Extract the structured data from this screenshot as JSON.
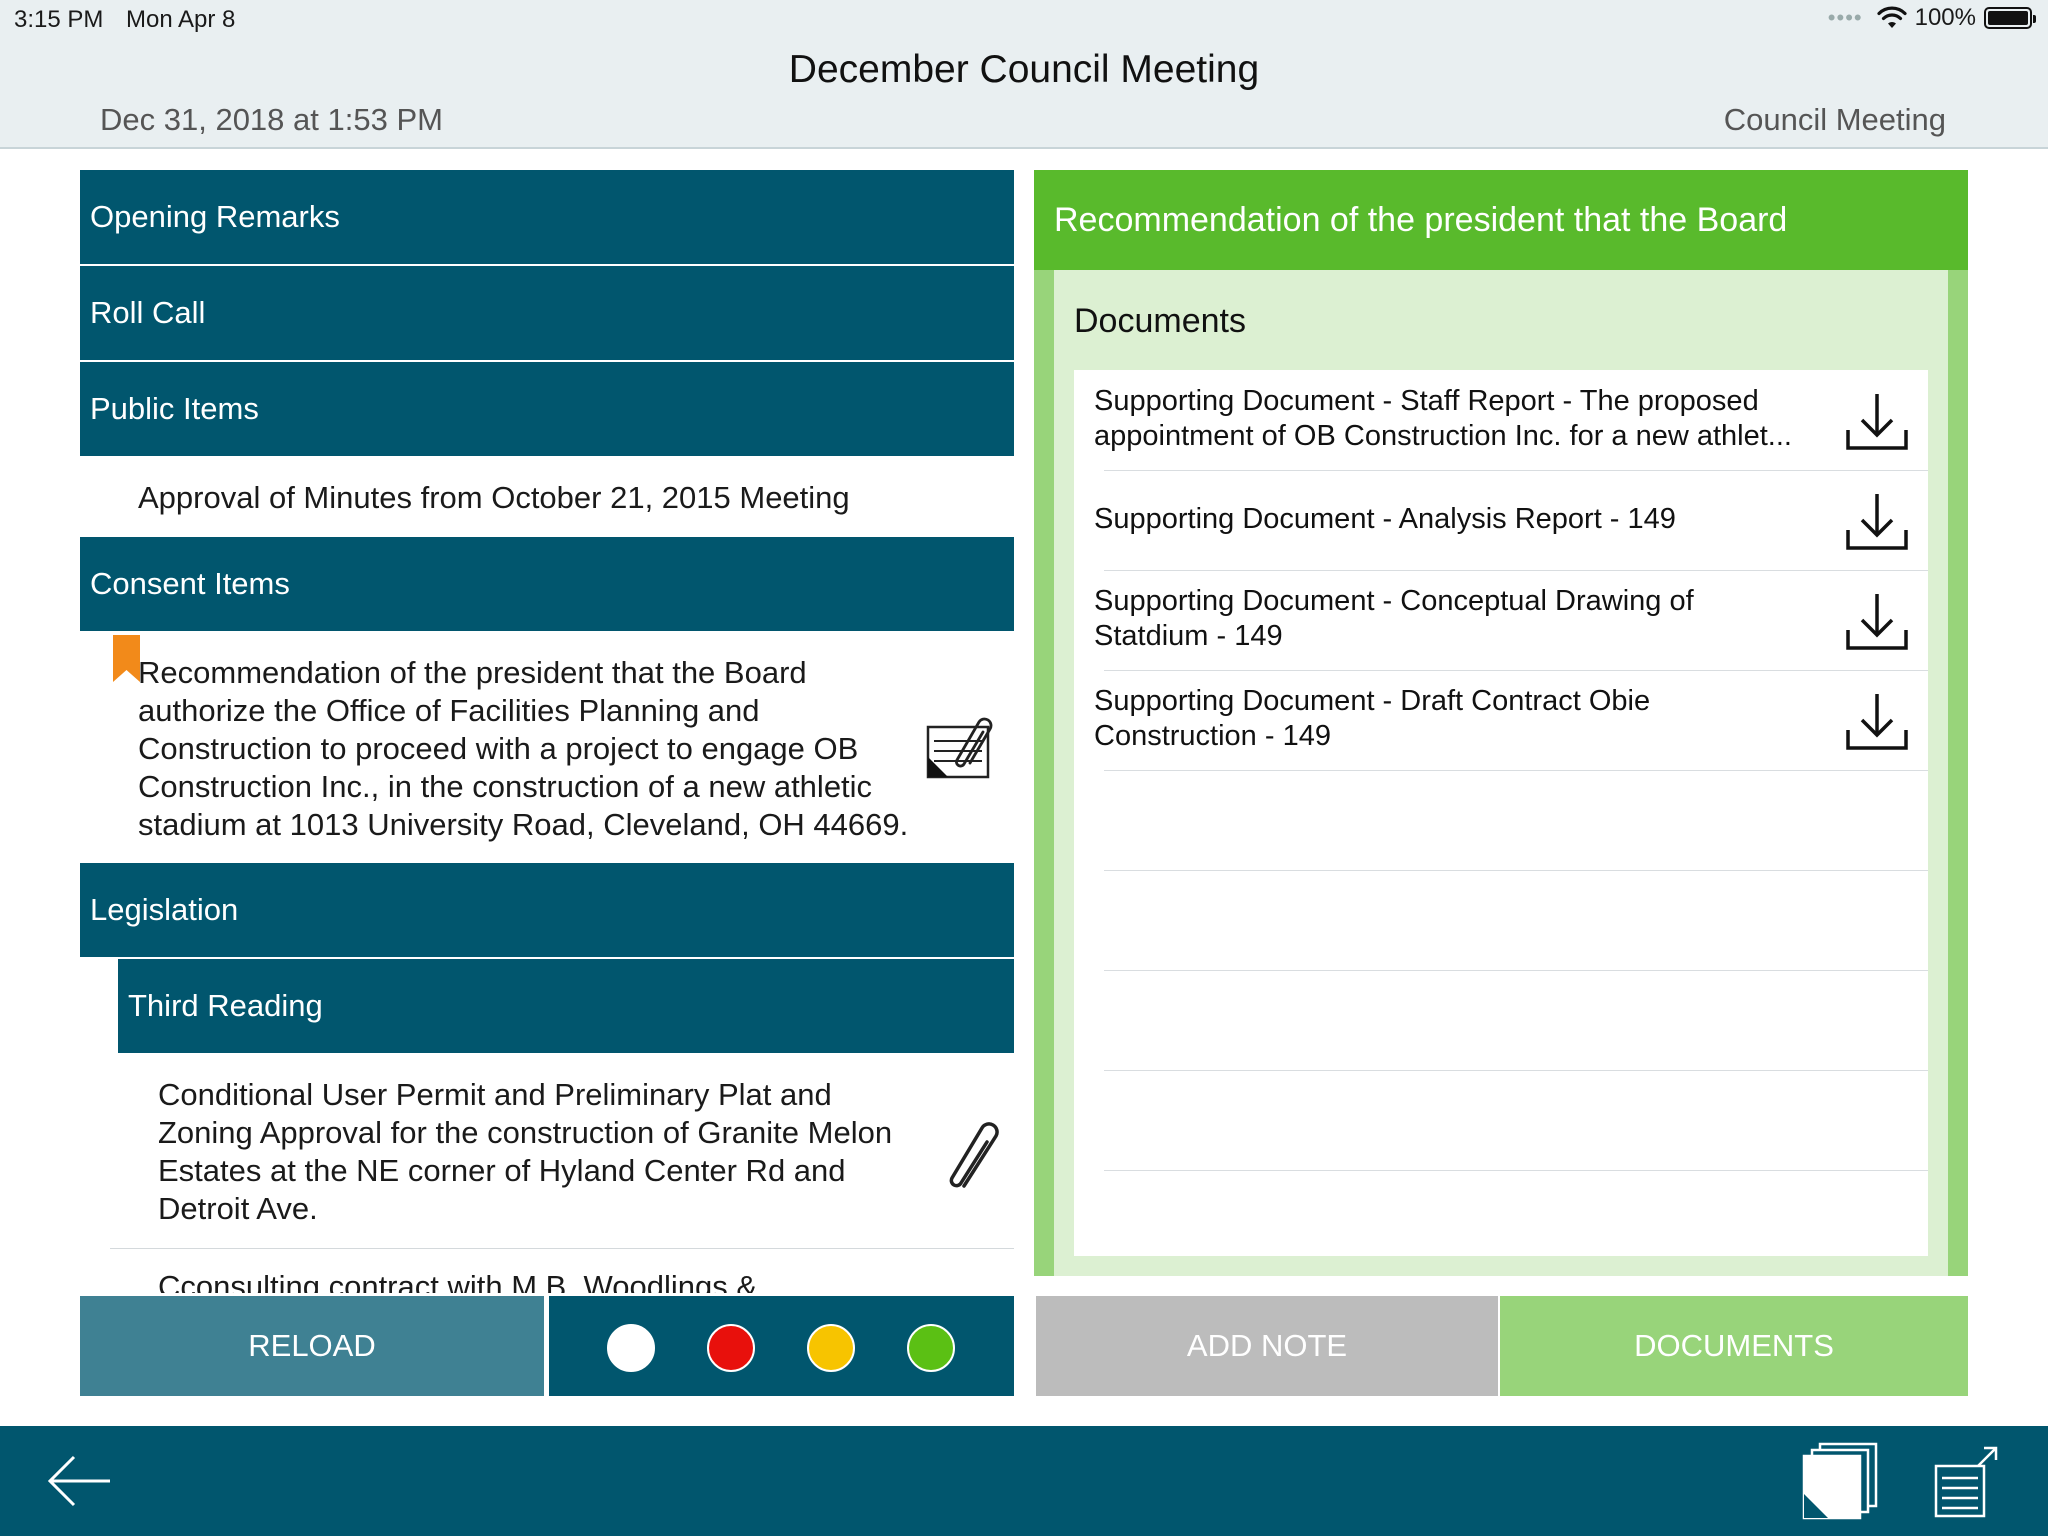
{
  "status_bar": {
    "time": "3:15 PM",
    "date": "Mon Apr 8",
    "battery": "100%",
    "icons": [
      "signal-dots-icon",
      "wifi-icon",
      "battery-icon"
    ]
  },
  "header": {
    "title": "December Council Meeting",
    "datetime": "Dec 31, 2018 at 1:53 PM",
    "meeting_type": "Council Meeting"
  },
  "agenda": {
    "sections": [
      "Opening Remarks",
      "Roll Call",
      "Public Items",
      "Consent Items",
      "Legislation"
    ],
    "subsections": [
      "Third Reading"
    ],
    "items": {
      "public_item_1": "Approval of Minutes from October 21, 2015 Meeting",
      "consent_item_1_lines": [
        "Recommendation of the president that the Board",
        "authorize the Office of Facilities Planning and",
        "Construction to proceed with a project to engage OB",
        "Construction Inc., in the construction of a new athletic",
        "stadium at 1013 University Road, Cleveland, OH 44669."
      ],
      "third_reading_item_1_lines": [
        "Conditional User Permit and Preliminary Plat and",
        "Zoning Approval for the construction of Granite Melon",
        "Estates at the NE corner of Hyland Center Rd and",
        "Detroit Ave."
      ],
      "third_reading_item_2_partial": "Cconsulting contract with M.B. Woodlings &"
    }
  },
  "toolbar_left": {
    "reload_label": "RELOAD",
    "colors": [
      "#ffffff",
      "#e8100c",
      "#f7c400",
      "#5bc014"
    ]
  },
  "detail": {
    "item_title": "Recommendation of the president that the Board",
    "documents_heading": "Documents",
    "documents": [
      {
        "line1": "Supporting Document - Staff Report - The proposed",
        "line2": "appointment of OB Construction Inc. for a new athlet..."
      },
      {
        "line1": "Supporting Document - Analysis Report - 149"
      },
      {
        "line1": "Supporting Document - Conceptual Drawing of",
        "line2": "Statdium - 149"
      },
      {
        "line1": "Supporting Document - Draft Contract Obie",
        "line2": "Construction - 149"
      }
    ]
  },
  "toolbar_right": {
    "add_note_label": "ADD NOTE",
    "documents_label": "DOCUMENTS"
  },
  "colors": {
    "section_bar": "#01566e",
    "reload": "#3f8193",
    "detail_header": "#59ba2c",
    "detail_panel": "#98d47a",
    "documents_box": "#dcf0d2",
    "bookmark": "#f28a1a"
  }
}
